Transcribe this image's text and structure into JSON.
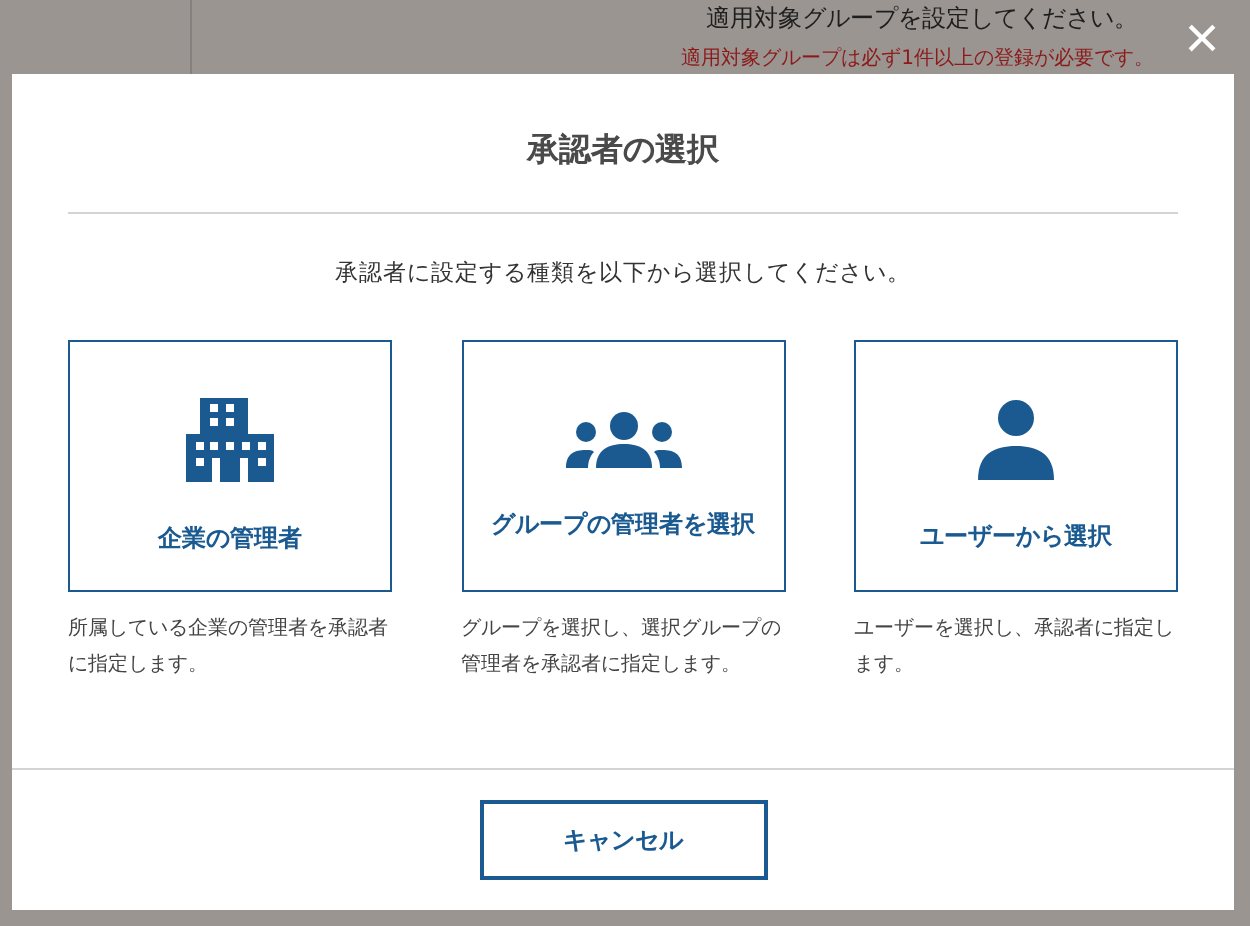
{
  "background": {
    "hint": "適用対象グループを設定してください。",
    "error": "適用対象グループは必ず1件以上の登録が必要です。"
  },
  "dialog": {
    "close": "×",
    "title": "承認者の選択",
    "instruction": "承認者に設定する種類を以下から選択してください。",
    "options": [
      {
        "kind": "company",
        "label": "企業の管理者",
        "description": "所属している企業の管理者を承認者に指定します。"
      },
      {
        "kind": "group",
        "label": "グループの管理者を選択",
        "description": "グループを選択し、選択グループの管理者を承認者に指定します。"
      },
      {
        "kind": "user",
        "label": "ユーザーから選択",
        "description": "ユーザーを選択し、承認者に指定します。"
      }
    ],
    "cancel": "キャンセル"
  }
}
